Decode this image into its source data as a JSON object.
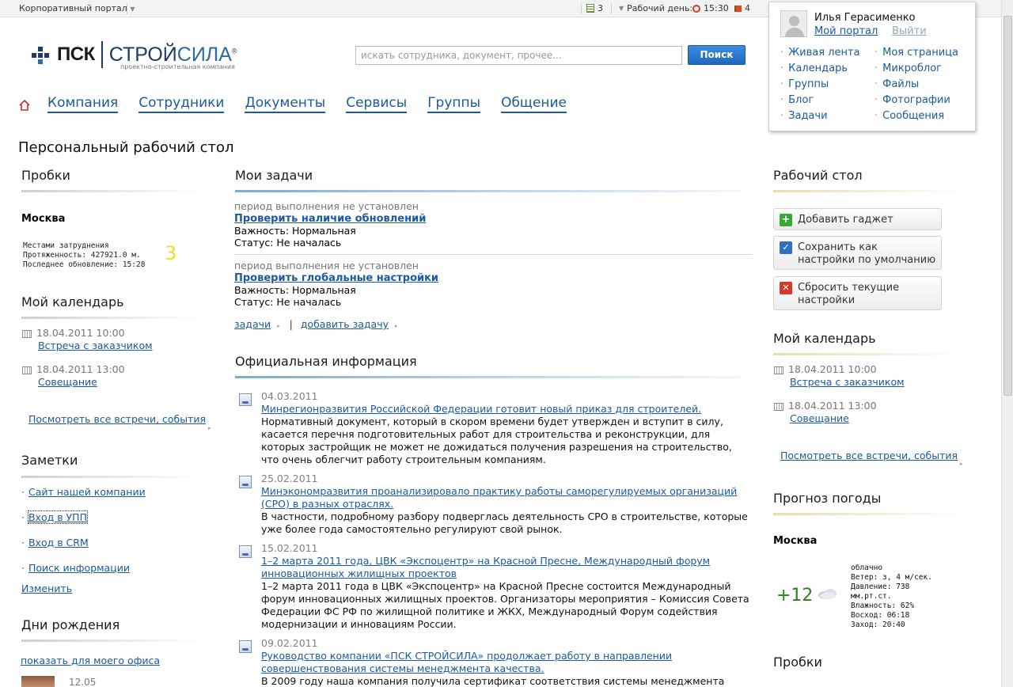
{
  "topbar": {
    "portal_label": "Корпоративный портал",
    "tasks_count": "3",
    "workday_label": "Рабочий день:",
    "time": "15:30",
    "flags_count": "4"
  },
  "header": {
    "logo_psk": "ПСК",
    "logo_stroy": "СТРОЙ",
    "logo_sila": "СИЛА",
    "logo_reg": "®",
    "logo_tagline": "проектно-строительная компания",
    "search_placeholder": "искать сотрудника, документ, прочее...",
    "search_button": "Поиск"
  },
  "nav": {
    "tabs": [
      "Компания",
      "Сотрудники",
      "Документы",
      "Сервисы",
      "Группы",
      "Общение"
    ]
  },
  "page_title": "Персональный рабочий стол",
  "user_popup": {
    "name": "Илья Герасименко",
    "my_portal": "Мой портал",
    "logout": "Выйти",
    "left_menu": [
      "Живая лента",
      "Календарь",
      "Группы",
      "Блог",
      "Задачи"
    ],
    "right_menu": [
      "Моя страница",
      "Микроблог",
      "Файлы",
      "Фотографии",
      "Сообщения"
    ]
  },
  "left": {
    "traffic_title": "Пробки",
    "traffic_city": "Москва",
    "traffic_line1": "Местами затруднения",
    "traffic_line2": "Протяженность: 427921.0 м.",
    "traffic_line3": "Последнее обновление: 15:28",
    "traffic_score": "3",
    "calendar_title": "Мой календарь",
    "events": [
      {
        "date": "18.04.2011 10:00",
        "title": "Встреча с заказчиком"
      },
      {
        "date": "18.04.2011 13:00",
        "title": "Совещание"
      }
    ],
    "all_events": "Посмотреть все встречи, события",
    "notes_title": "Заметки",
    "notes": [
      "Сайт нашей компании",
      "Вход в УПП",
      "Вход в CRM",
      "Поиск информации"
    ],
    "notes_edit": "Изменить",
    "birthdays_title": "Дни рождения",
    "birthdays_link": "показать для моего офиса",
    "birthday_date": "12.05"
  },
  "center": {
    "tasks_title": "Мои задачи",
    "tasks": [
      {
        "period": "период выполнения не установлен",
        "title": "Проверить наличие обновлений",
        "importance": "Важность: Нормальная",
        "status": "Статус: Не началась"
      },
      {
        "period": "период выполнения не установлен",
        "title": "Проверить глобальные настройки",
        "importance": "Важность: Нормальная",
        "status": "Статус: Не началась"
      }
    ],
    "tasks_link": "задачи",
    "add_task_link": "добавить задачу",
    "info_title": "Официальная информация",
    "news": [
      {
        "date": "04.03.2011",
        "title": "Минрегионразвития Российской Федерации готовит новый приказ для строителей.",
        "text": "Нормативный документ, который в скором времени будет утвержден и вступит в силу, касается перечня подготовительных работ для строительства и реконструкции, для которых застройщик не может не дожидаться получения разрешения на строительство, что очень облегчит работу строительным компаниям."
      },
      {
        "date": "25.02.2011",
        "title": "Минэкономразвития проанализировало практику работы саморегулируемых организаций (СРО) в разных отраслях.",
        "text": "В частности, подробному разбору подверглась деятельность СРО в строительстве, которые уже более года самостоятельно регулируют свой рынок."
      },
      {
        "date": "15.02.2011",
        "title": "1–2 марта 2011 года, ЦВК «Экспоцентр» на Красной Пресне, Международный форум инновационных жилищных проектов",
        "text": "1–2 марта 2011 года в ЦВК «Экспоцентр» на Красной Пресне состоится Международный форум инновационных жилищных проектов. Организаторы мероприятия – Комиссия Совета Федерации ФС РФ по жилищной политике и ЖКХ, Международный Форум содействия модернизации и инновациям России."
      },
      {
        "date": "09.02.2011",
        "title": "Руководство компании «ПСК СТРОЙСИЛА» продолжает работу в направлении совершенствования системы менеджмента качества.",
        "text": "В 2009 году наша компания получила  сертификат соответствия системы менеджмента"
      }
    ]
  },
  "right": {
    "desktop_title": "Рабочий стол",
    "add_gadget": "Добавить гаджет",
    "save_default": "Сохранить как настройки по умолчанию",
    "reset": "Сбросить текущие настройки",
    "calendar_title": "Мой календарь",
    "events": [
      {
        "date": "18.04.2011 10:00",
        "title": "Встреча с заказчиком"
      },
      {
        "date": "18.04.2011 13:00",
        "title": "Совещание"
      }
    ],
    "all_events": "Посмотреть все встречи, события",
    "weather_title": "Прогноз погоды",
    "weather_city": "Москва",
    "weather_temp": "+12",
    "weather_lines": [
      "облачно",
      "Ветер: з, 4 м/сек.",
      "Давление: 738",
      "мм.рт.ст.",
      "Влажность: 62%",
      "Восход: 06:18",
      "Заход: 20:40"
    ],
    "traffic_title": "Пробки"
  },
  "colors": {
    "link": "#1a5aa0",
    "traffic_score": "#f0e020",
    "temp": "#2e7d1f"
  }
}
